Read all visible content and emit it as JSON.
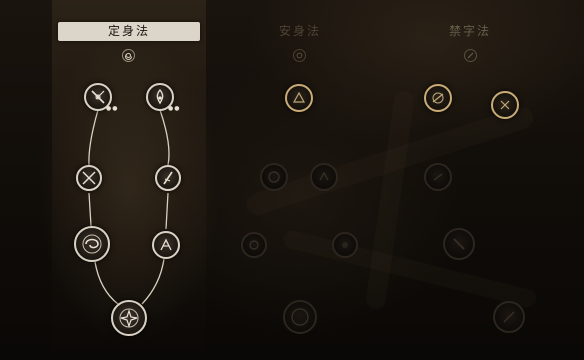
{
  "tabs": [
    {
      "label": "定身法",
      "state": "selected"
    },
    {
      "label": "安身法",
      "state": "dim"
    },
    {
      "label": "禁字法",
      "state": "dim"
    }
  ],
  "tree_left": {
    "points_invested": [
      2,
      2
    ]
  },
  "colors": {
    "tab_selected_bg": "#dcd6ca",
    "node_lit_border": "#d9d2c4",
    "node_gold_border": "#c9ab76",
    "node_dim_border": "#2c251d",
    "connector": "#d8d0c0"
  },
  "icons": {
    "tab_left_sub": "spiral-icon",
    "tab_mid_sub": "ring-icon",
    "tab_right_sub": "slash-circle-icon"
  }
}
